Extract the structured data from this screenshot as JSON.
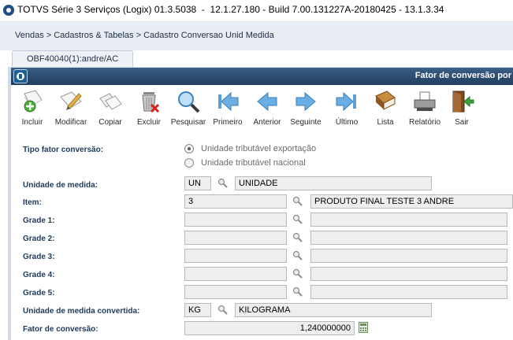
{
  "titlebar": {
    "title": "TOTVS Série 3 Serviços (Logix) 01.3.5038  -  12.1.27.180 - Build 7.00.131227A-20180425 - 13.1.3.34"
  },
  "breadcrumb": {
    "text": "Vendas > Cadastros & Tabelas > Cadastro Conversao Unid Medida"
  },
  "tab": {
    "label": "OBF40040(1):andre/AC"
  },
  "window": {
    "title": "Fator de conversão por"
  },
  "toolbar": {
    "incluir": "Incluir",
    "modificar": "Modificar",
    "copiar": "Copiar",
    "excluir": "Excluir",
    "pesquisar": "Pesquisar",
    "primeiro": "Primeiro",
    "anterior": "Anterior",
    "seguinte": "Seguinte",
    "ultimo": "Último",
    "lista": "Lista",
    "relatorio": "Relatório",
    "sair": "Sair"
  },
  "form": {
    "tipo_label": "Tipo fator conversão:",
    "radio_exportacao": "Unidade tributável exportação",
    "radio_nacional": "Unidade tributável nacional",
    "selected_radio": "exportacao",
    "um_label": "Unidade de medida:",
    "um_code": "UN",
    "um_desc": "UNIDADE",
    "item_label": "Item:",
    "item_code": "3",
    "item_desc": "PRODUTO FINAL TESTE 3 ANDRE",
    "grade1_label": "Grade 1:",
    "grade2_label": "Grade 2:",
    "grade3_label": "Grade 3:",
    "grade4_label": "Grade 4:",
    "grade5_label": "Grade 5:",
    "umc_label": "Unidade de medida convertida:",
    "umc_code": "KG",
    "umc_desc": "KILOGRAMA",
    "fator_label": "Fator de conversão:",
    "fator_value": "1,240000000"
  },
  "colors": {
    "header": "#2a4a6e",
    "label": "#1d3a5c",
    "field_bg": "#eeeeee"
  }
}
